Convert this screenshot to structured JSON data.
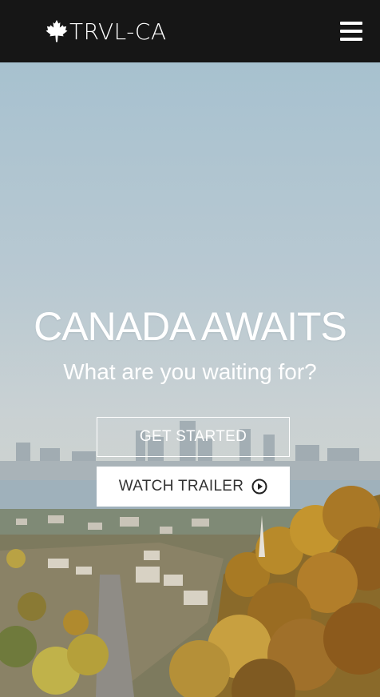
{
  "brand": {
    "name": "TRVL-CA",
    "icon": "maple-leaf-icon"
  },
  "nav": {
    "menu_icon": "hamburger-menu-icon"
  },
  "hero": {
    "title": "CANADA AWAITS",
    "subtitle": "What are you waiting for?",
    "primary_button": "GET STARTED",
    "secondary_button": "WATCH TRAILER",
    "secondary_icon": "play-circle-icon"
  },
  "colors": {
    "navbar_bg": "#161616",
    "text": "#ffffff",
    "button_text_dark": "#333333"
  }
}
